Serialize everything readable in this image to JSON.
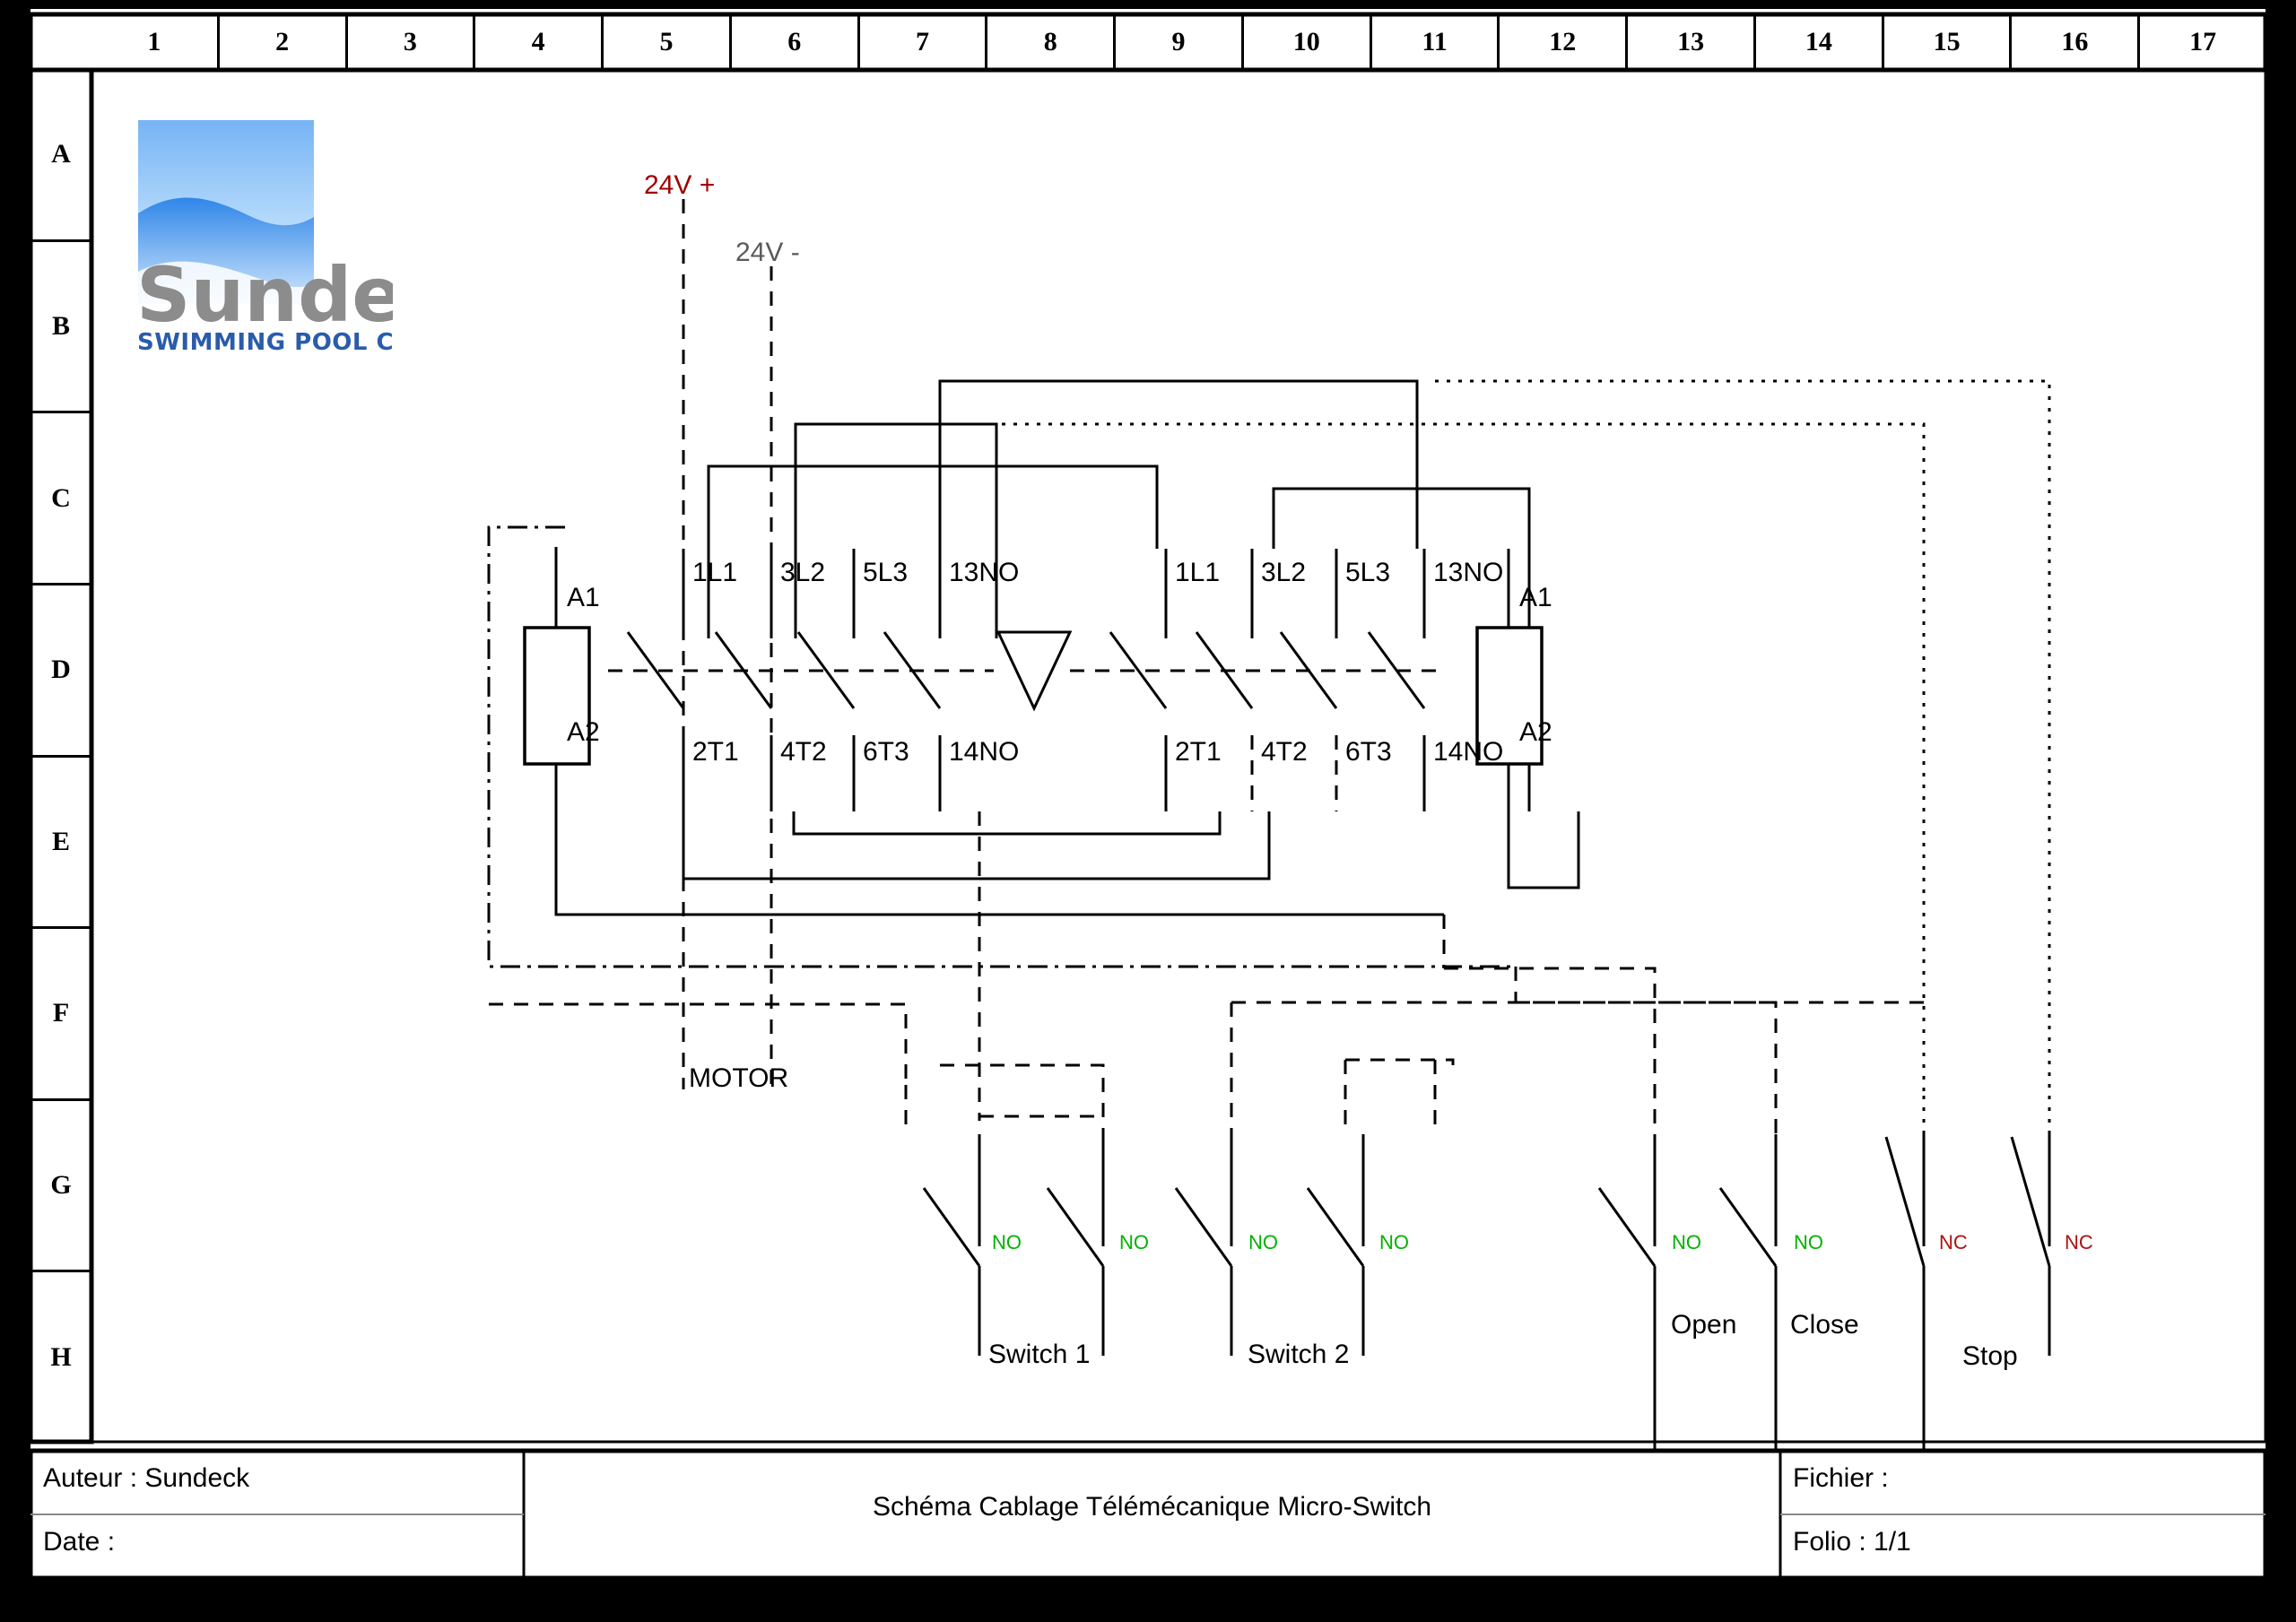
{
  "sheet": {
    "columns": [
      "1",
      "2",
      "3",
      "4",
      "5",
      "6",
      "7",
      "8",
      "9",
      "10",
      "11",
      "12",
      "13",
      "14",
      "15",
      "16",
      "17"
    ],
    "rows": [
      "A",
      "B",
      "C",
      "D",
      "E",
      "F",
      "G",
      "H"
    ]
  },
  "logo": {
    "brand": "Sundeck",
    "tagline": "SWIMMING POOL COVERS",
    "brand_color": "#8c8c8c",
    "tagline_color": "#2a5caa",
    "wave_color": "#2f86e8"
  },
  "power": {
    "positive": "24V +",
    "positive_color": "#a00000",
    "negative": "24V -",
    "negative_color": "#5a5a5a"
  },
  "contactor_left": {
    "coil_top": "A1",
    "coil_bottom": "A2",
    "terminals_top": [
      "1L1",
      "3L2",
      "5L3",
      "13NO"
    ],
    "terminals_bottom": [
      "2T1",
      "4T2",
      "6T3",
      "14NO"
    ]
  },
  "contactor_right": {
    "coil_top": "A1",
    "coil_bottom": "A2",
    "terminals_top": [
      "1L1",
      "3L2",
      "5L3",
      "13NO"
    ],
    "terminals_bottom": [
      "2T1",
      "4T2",
      "6T3",
      "14NO"
    ]
  },
  "motor": {
    "label": "MOTOR"
  },
  "switches": [
    {
      "group": "Switch 1",
      "contacts": [
        "NO",
        "NO"
      ]
    },
    {
      "group": "Switch 2",
      "contacts": [
        "NO",
        "NO"
      ]
    }
  ],
  "buttons": [
    {
      "label": "Open",
      "contact": "NO"
    },
    {
      "label": "Close",
      "contact": "NO"
    },
    {
      "label": "Stop",
      "contact": "NC"
    },
    {
      "label": "",
      "contact": "NC"
    }
  ],
  "contact_types": {
    "no": "NO",
    "nc": "NC",
    "no_color": "#00b200",
    "nc_color": "#b01010"
  },
  "titleblock": {
    "author": "Auteur : Sundeck",
    "date": "Date :",
    "title": "Schéma Cablage Télémécanique Micro-Switch",
    "file": "Fichier :",
    "folio": "Folio : 1/1"
  }
}
